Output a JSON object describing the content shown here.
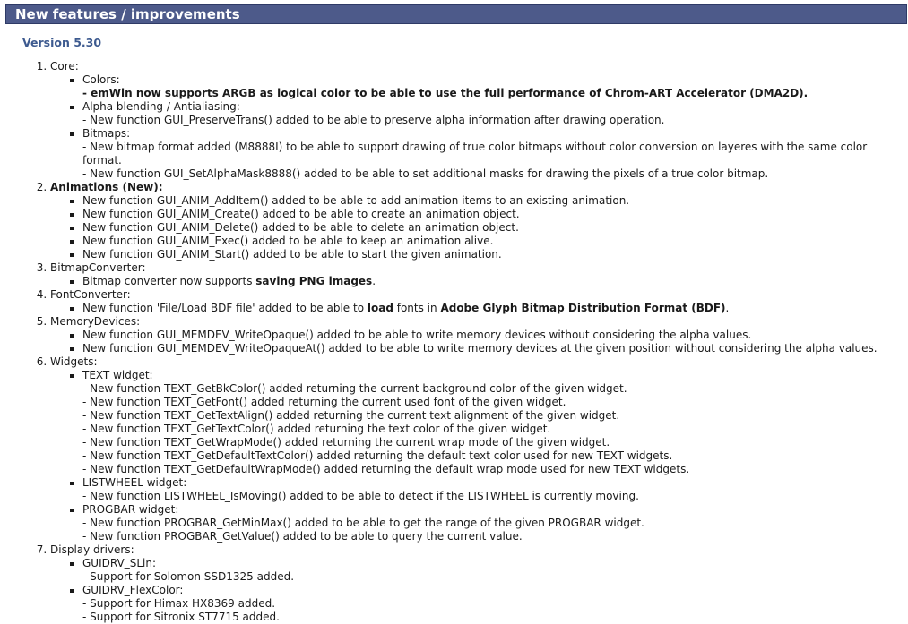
{
  "header": {
    "title": "New features / improvements"
  },
  "version": "Version 5.30",
  "sections": [
    {
      "label": "Core:",
      "items": [
        {
          "label": "Colors:",
          "details": [
            {
              "parts": [
                {
                  "t": "- emWin now supports ARGB as logical color to be able to use the full performance of Chrom-ART Accelerator (DMA2D).",
                  "b": true
                }
              ]
            }
          ]
        },
        {
          "label": "Alpha blending / Antialiasing:",
          "details": [
            {
              "parts": [
                {
                  "t": "- New function GUI_PreserveTrans() added to be able to preserve alpha information after drawing operation."
                }
              ]
            }
          ]
        },
        {
          "label": "Bitmaps:",
          "details": [
            {
              "parts": [
                {
                  "t": "- New bitmap format added (M8888I) to be able to support drawing of true color bitmaps without color conversion on layeres with the same color format."
                }
              ]
            },
            {
              "parts": [
                {
                  "t": "- New function GUI_SetAlphaMask8888() added to be able to set additional masks for drawing the pixels of a true color bitmap."
                }
              ]
            }
          ]
        }
      ]
    },
    {
      "label": "Animations (New):",
      "bold": true,
      "items": [
        {
          "label": "New function GUI_ANIM_AddItem() added to be able to add animation items to an existing animation."
        },
        {
          "label": "New function GUI_ANIM_Create() added to be able to create an animation object."
        },
        {
          "label": "New function GUI_ANIM_Delete() added to be able to delete an animation object."
        },
        {
          "label": "New function GUI_ANIM_Exec() added to be able to keep an animation alive."
        },
        {
          "label": "New function GUI_ANIM_Start() added to be able to start the given animation."
        }
      ]
    },
    {
      "label": "BitmapConverter:",
      "items": [
        {
          "parts": [
            {
              "t": "Bitmap converter now supports "
            },
            {
              "t": "saving PNG images",
              "b": true
            },
            {
              "t": "."
            }
          ]
        }
      ]
    },
    {
      "label": "FontConverter:",
      "items": [
        {
          "parts": [
            {
              "t": "New function 'File/Load BDF file' added to be able to "
            },
            {
              "t": "load",
              "b": true
            },
            {
              "t": " fonts in "
            },
            {
              "t": "Adobe Glyph Bitmap Distribution Format (BDF)",
              "b": true
            },
            {
              "t": "."
            }
          ]
        }
      ]
    },
    {
      "label": "MemoryDevices:",
      "items": [
        {
          "label": "New function GUI_MEMDEV_WriteOpaque() added to be able to write memory devices without considering the alpha values."
        },
        {
          "label": "New function GUI_MEMDEV_WriteOpaqueAt() added to be able to write memory devices at the given position without considering the alpha values."
        }
      ]
    },
    {
      "label": "Widgets:",
      "items": [
        {
          "label": "TEXT widget:",
          "details": [
            {
              "parts": [
                {
                  "t": "- New function TEXT_GetBkColor() added returning the current background color of the given widget."
                }
              ]
            },
            {
              "parts": [
                {
                  "t": "- New function TEXT_GetFont() added returning the current used font of the given widget."
                }
              ]
            },
            {
              "parts": [
                {
                  "t": "- New function TEXT_GetTextAlign() added returning the current text alignment of the given widget."
                }
              ]
            },
            {
              "parts": [
                {
                  "t": "- New function TEXT_GetTextColor() added returning the text color of the given widget."
                }
              ]
            },
            {
              "parts": [
                {
                  "t": "- New function TEXT_GetWrapMode() added returning the current wrap mode of the given widget."
                }
              ]
            },
            {
              "parts": [
                {
                  "t": "- New function TEXT_GetDefaultTextColor() added returning the default text color used for new TEXT widgets."
                }
              ]
            },
            {
              "parts": [
                {
                  "t": "- New function TEXT_GetDefaultWrapMode() added returning the default wrap mode used for new TEXT widgets."
                }
              ]
            }
          ]
        },
        {
          "label": "LISTWHEEL widget:",
          "details": [
            {
              "parts": [
                {
                  "t": "- New function LISTWHEEL_IsMoving() added to be able to detect if the LISTWHEEL is currently moving."
                }
              ]
            }
          ]
        },
        {
          "label": "PROGBAR widget:",
          "details": [
            {
              "parts": [
                {
                  "t": "- New function PROGBAR_GetMinMax() added to be able to get the range of the given PROGBAR widget."
                }
              ]
            },
            {
              "parts": [
                {
                  "t": "- New function PROGBAR_GetValue() added to be able to query the current value."
                }
              ]
            }
          ]
        }
      ]
    },
    {
      "label": "Display drivers:",
      "items": [
        {
          "label": "GUIDRV_SLin:",
          "details": [
            {
              "parts": [
                {
                  "t": "- Support for Solomon SSD1325 added."
                }
              ]
            }
          ]
        },
        {
          "label": "GUIDRV_FlexColor:",
          "details": [
            {
              "parts": [
                {
                  "t": "- Support for Himax HX8369 added."
                }
              ]
            },
            {
              "parts": [
                {
                  "t": "- Support for Sitronix ST7715 added."
                }
              ]
            }
          ]
        }
      ]
    }
  ]
}
